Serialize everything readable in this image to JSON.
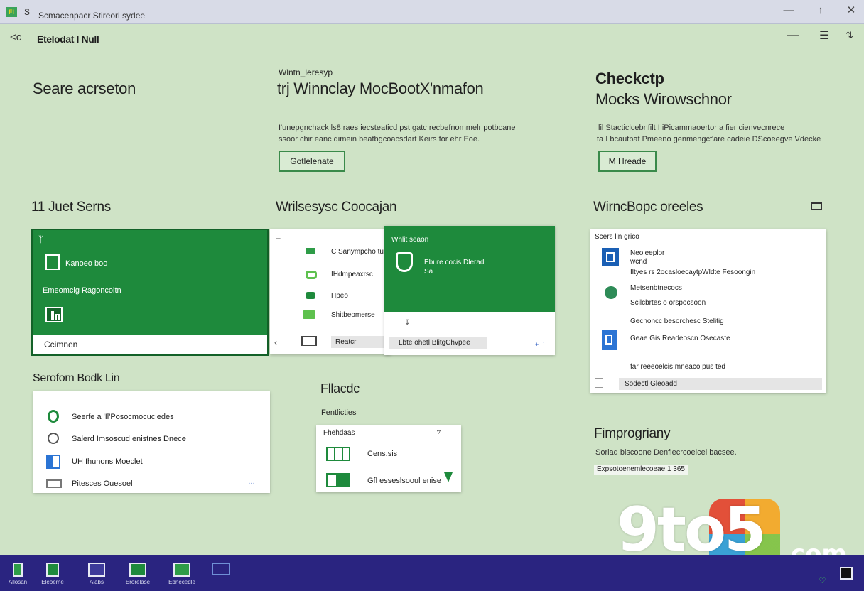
{
  "titlebar": {
    "app_icon": "Fl",
    "small_text": "S",
    "title": "Scmacenpacr Stireorl sydee",
    "minimize_icon": "minimize-icon",
    "maximize_icon": "maximize-icon",
    "close_icon": "close-icon"
  },
  "header": {
    "back_label": "<c",
    "title": "Etelodat I Null"
  },
  "intro": {
    "left_title": "Seare acrseton",
    "mid_small": "Wlntn_leresyp",
    "mid_title": "trj Winnclay MocBootX'nmafon",
    "mid_body_1": "I'unepgnchack ls8 raes iecsteaticd pst gatc recbefnommelr potbcane",
    "mid_body_2": "ssoor chir eanc dimein beatbgcoacsdart Keirs for ehr Eoe.",
    "mid_button": "Gotlelenate",
    "right_title_1": "Checkctp",
    "right_title_2": "Mocks Wirowschnor",
    "right_body_1": "lil Stacticlcebnfilt I iPicammaoertor a fier cienvecnrece",
    "right_body_2": "ta I bcautbat Pmeeno genmengcf'are cadeie DScoeegve Vdecke",
    "right_button": "M Hreade"
  },
  "row2": {
    "col1_title": "11 Juet Serns",
    "col2_title": "Wrilsesysc Coocajan",
    "col3_title": "WirncBopc oreeles",
    "col3_icon": "comment-icon"
  },
  "green_card": {
    "corner_glyph": "ᛉ",
    "item1": "Kanoeo boo",
    "item2": "Emeomcig Ragoncoitn",
    "footer": "Ccimnen"
  },
  "mid_card": {
    "items": [
      "C Sanympcho tuel",
      "IHdmpeaxrsc",
      "Hpeo",
      "Shitbeomerse"
    ],
    "bottom_label": "Reatcr",
    "overlay_title": "Whlit seaon",
    "overlay_text_1": "Ebure cocis Dlerad",
    "overlay_text_2": "Sa",
    "overlay_bottom": "Lbte ohetl BlitgChvpee"
  },
  "right_card": {
    "header": "Scers lin grico",
    "items": [
      "Neoleeplor",
      "wcnd",
      "Iltyes  rs  2ocasloecaytpWldte Fesoongin",
      "Metsenbtnecocs",
      "Scilcbrtes o orspocsoon",
      "Gecnoncc besorchesc Stelitig",
      "Geae Gis Readeoscn Osecaste",
      "far reeeoelcis mneaco pus ted"
    ],
    "footer": "Sodectl Gleoadd"
  },
  "row3": {
    "col1_title": "Serofom  Bodk Lin",
    "list": [
      "Seerfe a 'Il'Posocmocuciedes",
      "Salerd Imsoscud enistnes Dnece",
      "UH Ihunons Moeclet",
      "Pitesces Ouesoel"
    ],
    "col2_title": "Fllacdc",
    "col2_small": "Fentlicties",
    "col2_card_header": "Fhehdaas",
    "col2_items": [
      "Cens.sis",
      "Gfl esseslsooul enise"
    ],
    "col3_title": "Fimprogriany",
    "col3_body": "Sorlad biscoone  Denfiecrcoelcel bacsee.",
    "col3_chip": "Expsotoenemlecoeae 1 365"
  },
  "taskbar": {
    "items": [
      "Allosan",
      "Eleoeme",
      "Alabs",
      "Erorelase",
      "Ebnecedle"
    ]
  },
  "watermark": {
    "text": "9to5",
    "suffix": ".com"
  },
  "colors": {
    "accent_green": "#1e8a3c",
    "background": "#cfe3c6",
    "taskbar": "#2a2480"
  }
}
